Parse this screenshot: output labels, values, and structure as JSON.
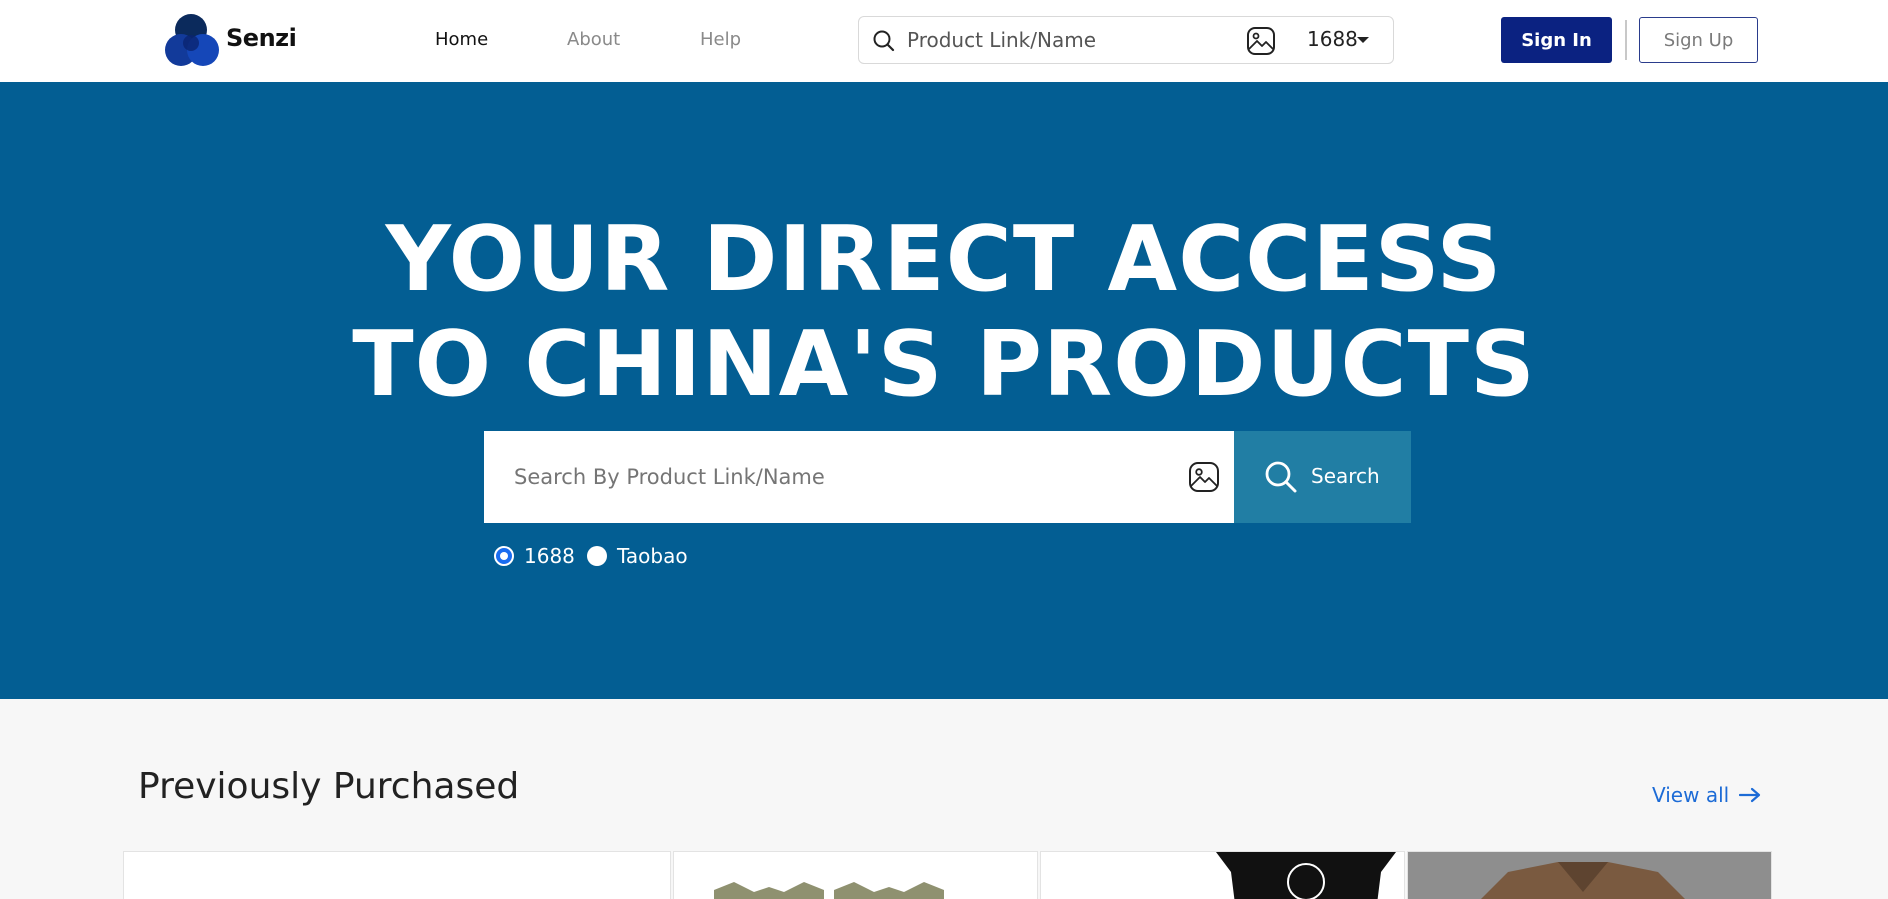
{
  "brand": {
    "name": "Senzi"
  },
  "nav": {
    "home": "Home",
    "about": "About",
    "help": "Help"
  },
  "header_search": {
    "placeholder": "Product Link/Name",
    "platform": "1688"
  },
  "auth": {
    "sign_in": "Sign In",
    "sign_up": "Sign Up"
  },
  "hero": {
    "line1": "YOUR DIRECT ACCESS",
    "line2": "TO CHINA'S PRODUCTS",
    "search_placeholder": "Search By Product Link/Name",
    "search_button": "Search",
    "platforms": [
      "1688",
      "Taobao"
    ],
    "selected_platform": "1688"
  },
  "section": {
    "title": "Previously Purchased",
    "view_all": "View all"
  },
  "colors": {
    "hero_bg": "#035e93",
    "primary_button": "#0b2281",
    "search_button": "#217ea4",
    "link": "#1c6bd6"
  }
}
